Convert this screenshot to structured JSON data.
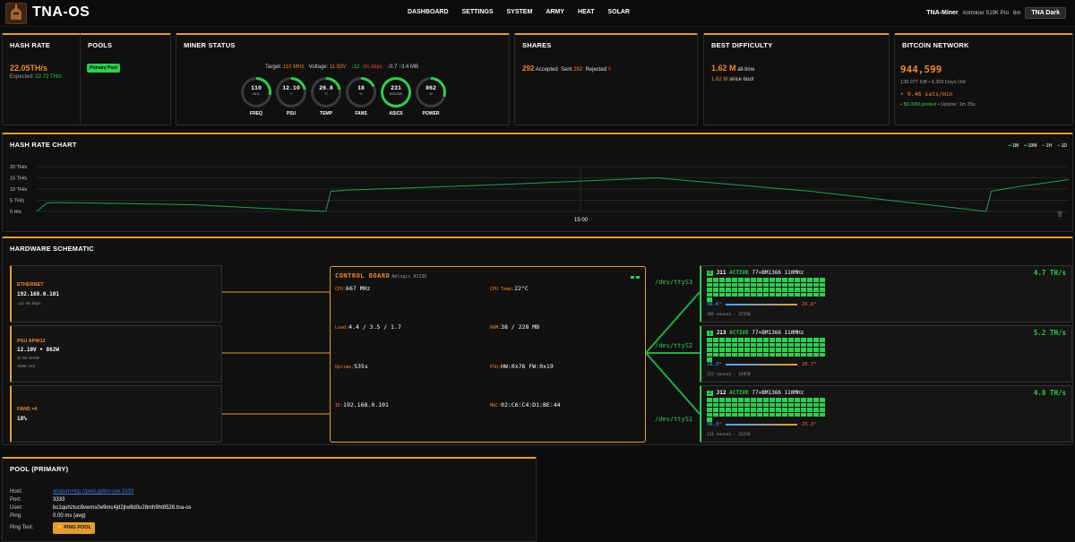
{
  "app": {
    "title": "TNA-OS"
  },
  "nav": {
    "items": [
      "DASHBOARD",
      "SETTINGS",
      "SYSTEM",
      "ARMY",
      "HEAT",
      "SOLAR"
    ]
  },
  "header": {
    "miner_name": "TNA-Miner",
    "model": "Antminer S19K Pro",
    "globe": "6m",
    "theme": "TNA Dark"
  },
  "hashrate": {
    "title": "HASH RATE",
    "value": "22.05TH/s",
    "expected_label": "Expected:",
    "expected_value": "22.72 TH/s"
  },
  "pools": {
    "title": "POOLS",
    "badge": "Primary Pool"
  },
  "miner_status": {
    "title": "MINER STATUS",
    "target_label": "Target:",
    "target_value": "110 MHz",
    "voltage_label": "Voltage:",
    "voltage_value": "11.92V",
    "net_down": "↓12",
    "net_up": "↑91 kbps",
    "mem": "↓0.7 ↑3.4 MB",
    "gauges": [
      {
        "value": "110",
        "unit": "MHz",
        "label": "FREQ",
        "fraction": 0.28
      },
      {
        "value": "12.10",
        "unit": "V",
        "label": "PSU",
        "fraction": 0.22
      },
      {
        "value": "26.8",
        "unit": "°C",
        "label": "TEMP",
        "fraction": 0.22
      },
      {
        "value": "18",
        "unit": "%",
        "label": "FANS",
        "fraction": 0.18
      },
      {
        "value": "231",
        "unit": "BM1366",
        "label": "ASICS",
        "fraction": 1.0
      },
      {
        "value": "862",
        "unit": "W",
        "label": "POWER",
        "fraction": 0.3
      }
    ]
  },
  "shares": {
    "title": "SHARES",
    "accepted": "292",
    "accepted_label": "Accepted",
    "sent_label": "Sent",
    "sent": "292",
    "rejected_label": "Rejected",
    "rejected": "0"
  },
  "best_difficulty": {
    "title": "BEST DIFFICULTY",
    "alltime_value": "1.62 M",
    "alltime_label": "all-time",
    "boot_value": "1.62 M",
    "boot_label": "since boot"
  },
  "bitcoin": {
    "title": "BITCOIN NETWORK",
    "height": "944,599",
    "diff_line": "138.97T Diff • 6,306 Days Old",
    "fee": "• 0.46 sats/min",
    "printed": "• $9.03M printed",
    "uptime": "• Uptime: 1m 35s"
  },
  "hashchart": {
    "title": "HASH RATE CHART",
    "ranges": [
      "1M",
      "10M",
      "1H",
      "1D"
    ]
  },
  "chart_data": {
    "type": "line",
    "title": "HASH RATE CHART",
    "xlabel": "",
    "ylabel": "",
    "yticks": [
      "20 TH/s",
      "15 TH/s",
      "10 TH/s",
      "5 TH/s",
      "0 H/s"
    ],
    "ylim": [
      0,
      20
    ],
    "x_tick_label": "15:00",
    "grid": true,
    "series": [
      {
        "color": "#1f9e57",
        "x": [
          0,
          1,
          2,
          15,
          28,
          28.5,
          30,
          45,
          60,
          75,
          92,
          92.5,
          95,
          100
        ],
        "values": [
          0,
          3.8,
          4,
          3,
          0,
          9,
          9.5,
          12,
          15,
          9,
          0,
          9,
          11,
          14.2
        ]
      }
    ]
  },
  "hardware": {
    "title": "HARDWARE SCHEMATIC",
    "ethernet": {
      "title": "ETHERNET",
      "ip": "192.168.0.101",
      "traffic": "↓12 ↑91 kbps"
    },
    "psu": {
      "title": "PSU APW12",
      "reading": "12.10V • 862W",
      "efficiency": "37.94 GH/W",
      "state": "State: 0x1"
    },
    "fans": {
      "title": "FANS ×4",
      "value": "18%"
    },
    "control": {
      "title": "CONTROL BOARD",
      "subtitle": "Amlogic A113D",
      "cpu_label": "CPU:",
      "cpu": "667 MHz",
      "cputemp_label": "CPU Temp:",
      "cputemp": "22°C",
      "load_label": "Load:",
      "load": "4.4 / 3.5 / 1.7",
      "ram_label": "RAM:",
      "ram": "38 / 228 MB",
      "uptime_label": "Uptime:",
      "uptime": "535s",
      "psu_label": "PSU:",
      "psu": "HW:0x76 FW:0x19",
      "ip_label": "IP:",
      "ip": "192.168.0.101",
      "mac_label": "MAC:",
      "mac": "02:C6:C4:D1:BE:44"
    },
    "ports": [
      "/dev/ttyS3",
      "/dev/ttyS2",
      "/dev/ttyS1"
    ],
    "chains": [
      {
        "index": "0",
        "name": "J11",
        "status": "ACTIVE",
        "spec": "77×BM1366 110MHz",
        "hashrate": "4.7 TH/s",
        "temp_low": "36.6°",
        "temp_high": "26.8°",
        "nonces": "205 nonces · 22550"
      },
      {
        "index": "1",
        "name": "J13",
        "status": "ACTIVE",
        "spec": "77×BM1366 110MHz",
        "hashrate": "5.2 TH/s",
        "temp_low": "16.3°",
        "temp_high": "26.7°",
        "nonces": "227 nonces · 24970"
      },
      {
        "index": "2",
        "name": "J12",
        "status": "ACTIVE",
        "spec": "77×BM1366 110MHz",
        "hashrate": "4.8 TH/s",
        "temp_low": "36.3°",
        "temp_high": "25.3°",
        "nonces": "211 nonces · 23210"
      }
    ]
  },
  "pool_primary": {
    "title": "POOL (PRIMARY)",
    "host_label": "Host:",
    "host": "stratum+tcp://pool.gobrrr.me:3333",
    "port_label": "Port:",
    "port": "3333",
    "user_label": "User:",
    "user": "bc1quhztuc8vwms0e9mc4jd2jtw9d0u28mh9ht8528.tna-os",
    "ping_label": "Ping:",
    "ping": "0.00 ms (avg)",
    "pingtest_label": "Ping Test:",
    "ping_button": "⚡ PING POOL"
  }
}
